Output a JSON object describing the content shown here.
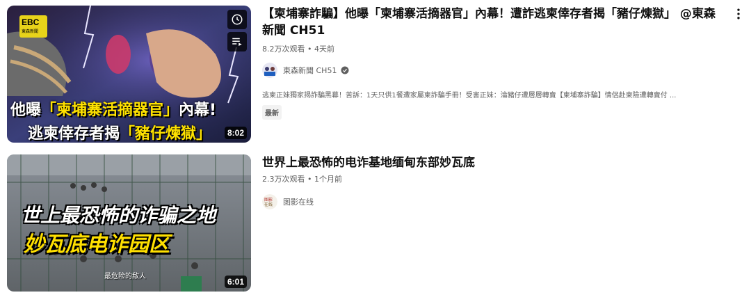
{
  "videos": [
    {
      "title": "【柬埔寨詐騙】他曝「柬埔寨活摘器官」內幕！遭詐逃柬倖存者揭「豬仔煉獄」 @東森新聞 CH51",
      "stats": "8.2万次观看 • 4天前",
      "channel": "東森新聞 CH51",
      "verified": true,
      "description": "逃柬正妹獨家揭詐騙黑幕！苦訴：1天只供1餐遭家屬柬詐騙手冊！受害正妹：淪豬仔遭層層轉賣【柬埔寨詐騙】情侶赴柬險遭轉賣付 ...",
      "badge": "最新",
      "duration": "8:02",
      "thumbnail": {
        "logo_main": "EBC",
        "logo_sub": "東森新聞",
        "line1_prefix": "他曝",
        "line1_highlight": "「柬埔寨活摘器官」",
        "line1_suffix": "內幕!",
        "line2_prefix": "逃柬倖存者揭",
        "line2_highlight": "「豬仔煉獄」"
      }
    },
    {
      "title": "世界上最恐怖的电诈基地缅甸东部妙瓦底",
      "stats": "2.3万次观看 • 1个月前",
      "channel": "图影在线",
      "verified": false,
      "duration": "6:01",
      "thumbnail": {
        "line1": "世上最恐怖的诈骗之地",
        "line2": "妙瓦底电诈园区",
        "caption": "最危险的敌人"
      }
    }
  ],
  "icons": {
    "watch_later": "clock-icon",
    "add_to_queue": "queue-icon",
    "more": "more-vertical-icon",
    "verified": "verified-check-icon"
  },
  "colors": {
    "title": "#0f0f0f",
    "secondary": "#606060",
    "thumb_highlight": "#ffe200"
  }
}
